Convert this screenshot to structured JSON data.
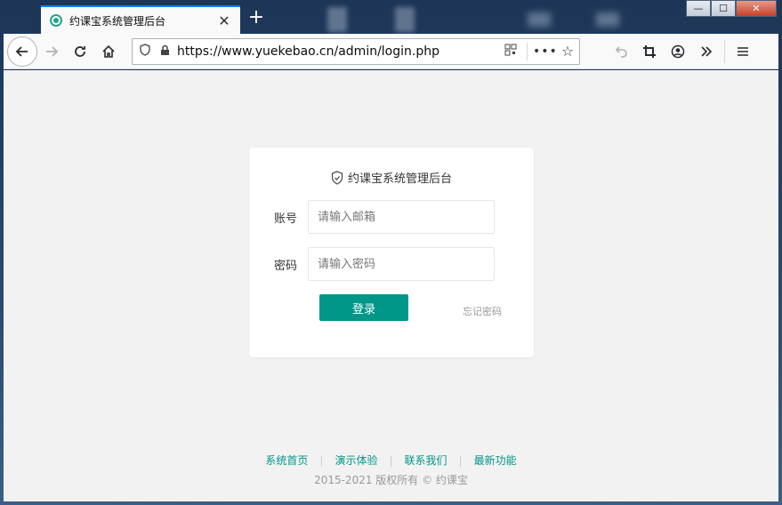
{
  "browser": {
    "tab_title": "约课宝系统管理后台",
    "tab_close": "✕",
    "new_tab": "+",
    "url": "https://www.yuekebao.cn/admin/login.php",
    "window_controls": {
      "minimize": "—",
      "maximize": "☐",
      "close": "✕"
    }
  },
  "login": {
    "title": "约课宝系统管理后台",
    "account_label": "账号",
    "account_placeholder": "请输入邮箱",
    "password_label": "密码",
    "password_placeholder": "请输入密码",
    "submit_label": "登录",
    "forgot_label": "忘记密码"
  },
  "footer": {
    "links": [
      "系统首页",
      "演示体验",
      "联系我们",
      "最新功能"
    ],
    "separator": "|",
    "copyright": "2015-2021 版权所有 © 约课宝"
  },
  "colors": {
    "accent": "#009688",
    "tab_indicator": "#0a84ff"
  }
}
